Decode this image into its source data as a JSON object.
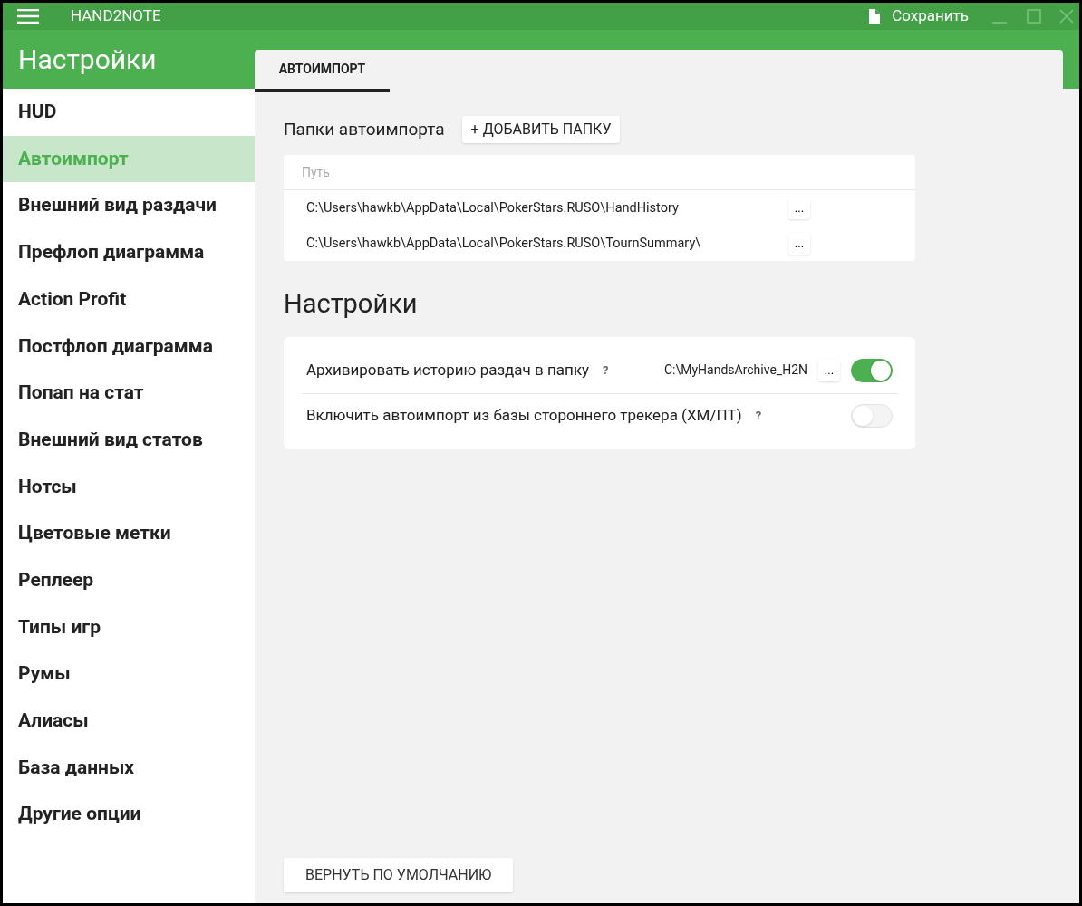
{
  "titlebar": {
    "app_name": "HAND2NOTE",
    "save_label": "Сохранить"
  },
  "header": {
    "title": "Настройки"
  },
  "sidebar": {
    "items": [
      {
        "label": "HUD",
        "selected": false
      },
      {
        "label": "Автоимпорт",
        "selected": true
      },
      {
        "label": "Внешний вид раздачи",
        "selected": false
      },
      {
        "label": "Префлоп диаграмма",
        "selected": false
      },
      {
        "label": "Action Profit",
        "selected": false
      },
      {
        "label": "Постфлоп диаграмма",
        "selected": false
      },
      {
        "label": "Попап на стат",
        "selected": false
      },
      {
        "label": "Внешний вид статов",
        "selected": false
      },
      {
        "label": "Нотсы",
        "selected": false
      },
      {
        "label": "Цветовые метки",
        "selected": false
      },
      {
        "label": "Реплеер",
        "selected": false
      },
      {
        "label": "Типы игр",
        "selected": false
      },
      {
        "label": "Румы",
        "selected": false
      },
      {
        "label": "Алиасы",
        "selected": false
      },
      {
        "label": "База данных",
        "selected": false
      },
      {
        "label": "Другие опции",
        "selected": false
      }
    ]
  },
  "tabs": [
    {
      "label": "АВТОИМПОРТ",
      "selected": true
    }
  ],
  "folders": {
    "title": "Папки автоимпорта",
    "add_button": "+ ДОБАВИТЬ ПАПКУ",
    "column": "Путь",
    "rows": [
      {
        "path": "C:\\Users\\hawkb\\AppData\\Local\\PokerStars.RUSO\\HandHistory",
        "button": "..."
      },
      {
        "path": "C:\\Users\\hawkb\\AppData\\Local\\PokerStars.RUSO\\TournSummary\\",
        "button": "..."
      }
    ]
  },
  "settings": {
    "title": "Настройки",
    "rows": [
      {
        "kind": "path",
        "label": "Архивировать историю раздач в папку",
        "help": "?",
        "value": "C:\\MyHandsArchive_H2N",
        "button": "...",
        "on": true
      },
      {
        "kind": "plain",
        "label": "Включить автоимпорт из базы стороннего трекера (ХМ/ПТ)",
        "help": "?",
        "on": false
      }
    ]
  },
  "reset_button": "ВЕРНУТЬ ПО УМОЛЧАНИЮ"
}
